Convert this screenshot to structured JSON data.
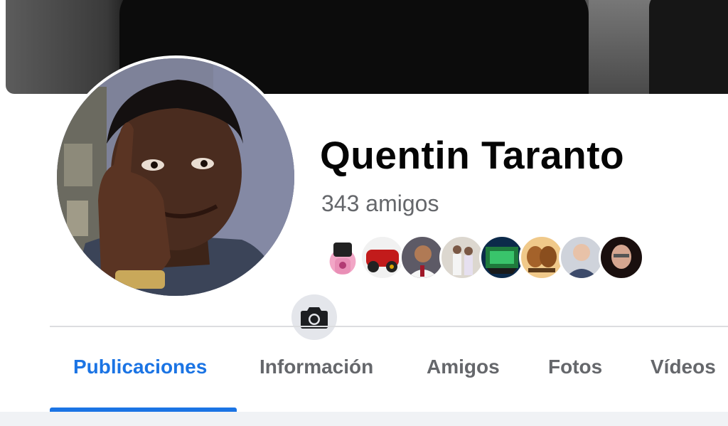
{
  "profile": {
    "name": "Quentin Taranto",
    "friends_count_text": "343 amigos"
  },
  "cover": {
    "icon": "cover-photo"
  },
  "avatar": {
    "camera_icon": "camera-icon"
  },
  "friend_avatars_count": 8,
  "tabs": [
    {
      "label": "Publicaciones",
      "active": true
    },
    {
      "label": "Información",
      "active": false
    },
    {
      "label": "Amigos",
      "active": false
    },
    {
      "label": "Fotos",
      "active": false
    },
    {
      "label": "Vídeos",
      "active": false
    }
  ],
  "colors": {
    "accent": "#1b74e4",
    "secondary_text": "#65676b",
    "primary_text": "#050505",
    "camera_button_bg": "#e4e6eb"
  }
}
